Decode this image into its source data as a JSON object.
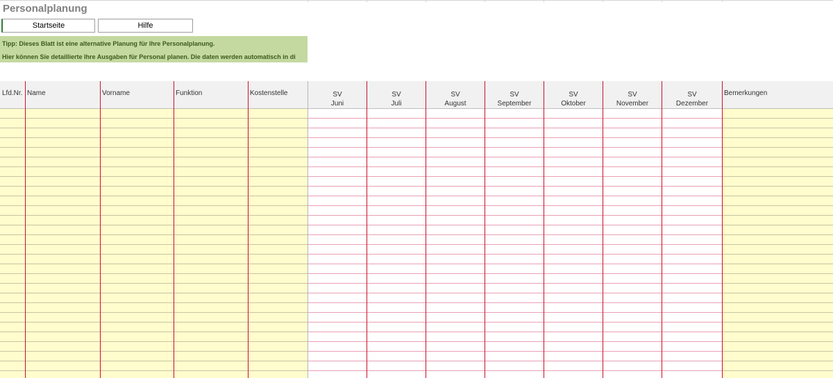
{
  "sheet": {
    "title": "Personalplanung"
  },
  "buttons": {
    "start_label": "Startseite",
    "help_label": "Hilfe"
  },
  "tip": {
    "line1": "Tipp: Dieses Blatt ist eine alternative Planung für Ihre Personalplanung.",
    "line2": "Hier können Sie detaillierte Ihre Ausgaben für Personal planen. Die daten werden automatisch in di"
  },
  "columns": {
    "lfd_nr": "Lfd.Nr.",
    "name": "Name",
    "vorname": "Vorname",
    "funktion": "Funktion",
    "kostenstelle": "Kostenstelle",
    "bemerkungen": "Bemerkungen",
    "sv_label": "SV",
    "months": [
      "Juni",
      "Juli",
      "August",
      "September",
      "Oktober",
      "November",
      "Dezember"
    ]
  },
  "colors": {
    "input_fill": "#fffccd",
    "tip_fill": "#c4d9a0",
    "column_border": "#c8102e",
    "header_fill": "#f1f1f1"
  }
}
